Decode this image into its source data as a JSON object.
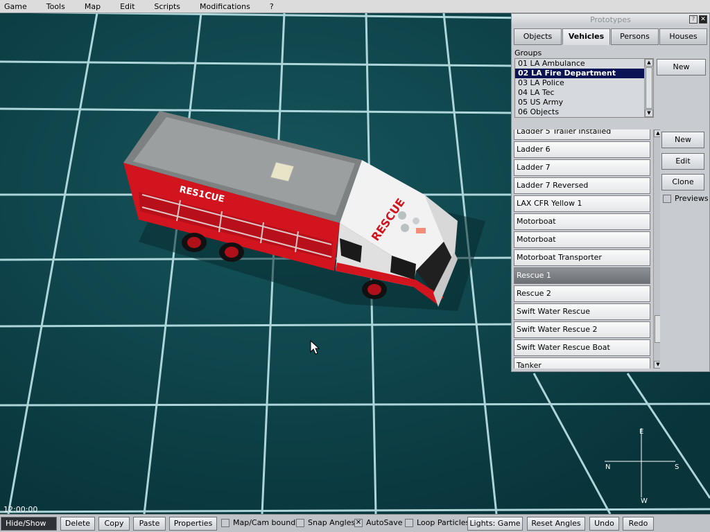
{
  "menu": [
    "Game",
    "Tools",
    "Map",
    "Edit",
    "Scripts",
    "Modifications",
    "?"
  ],
  "viewport": {
    "vehicle_side_text": "RES1CUE",
    "vehicle_cab_text": "RESCUE",
    "clock": "12:00:00",
    "compass": {
      "north": "N",
      "south": "S",
      "east": "E",
      "west": "W"
    }
  },
  "panel": {
    "title": "Prototypes",
    "help_label": "?",
    "tabs": [
      "Objects",
      "Vehicles",
      "Persons",
      "Houses"
    ],
    "active_tab": "Vehicles",
    "groups_label": "Groups",
    "groups": [
      "01 LA Ambulance",
      "02 LA Fire Department",
      "03 LA Police",
      "04 LA Tec",
      "05 US Army",
      "06 Objects"
    ],
    "selected_group": "02 LA Fire Department",
    "group_new_label": "New",
    "vehicles": [
      "Ladder 5 Trailer Installed",
      "Ladder 6",
      "Ladder 7",
      "Ladder 7 Reversed",
      "LAX CFR Yellow 1",
      "Motorboat",
      "Motorboat",
      "Motorboat Transporter",
      "Rescue 1",
      "Rescue 2",
      "Swift Water Rescue",
      "Swift Water Rescue 2",
      "Swift Water Rescue Boat",
      "Tanker"
    ],
    "selected_vehicle": "Rescue 1",
    "new_label": "New",
    "edit_label": "Edit",
    "clone_label": "Clone",
    "previews_label": "Previews",
    "previews_checked": false
  },
  "toolbar": {
    "hide_show": "Hide/Show",
    "delete": "Delete",
    "copy": "Copy",
    "paste": "Paste",
    "properties": "Properties",
    "map_cam_bounds": {
      "label": "Map/Cam bounds",
      "checked": false
    },
    "snap_angles": {
      "label": "Snap Angles",
      "checked": false
    },
    "autosave": {
      "label": "AutoSave",
      "checked": true
    },
    "loop_particles": {
      "label": "Loop Particles",
      "checked": false
    },
    "lights": "Lights: Game",
    "reset_angles": "Reset Angles",
    "undo": "Undo",
    "redo": "Redo"
  },
  "colors": {
    "grid_background": "#0e4248",
    "grid_lines": "#bfe6ea",
    "truck_red": "#d2141e",
    "selection": "#0a1454"
  }
}
